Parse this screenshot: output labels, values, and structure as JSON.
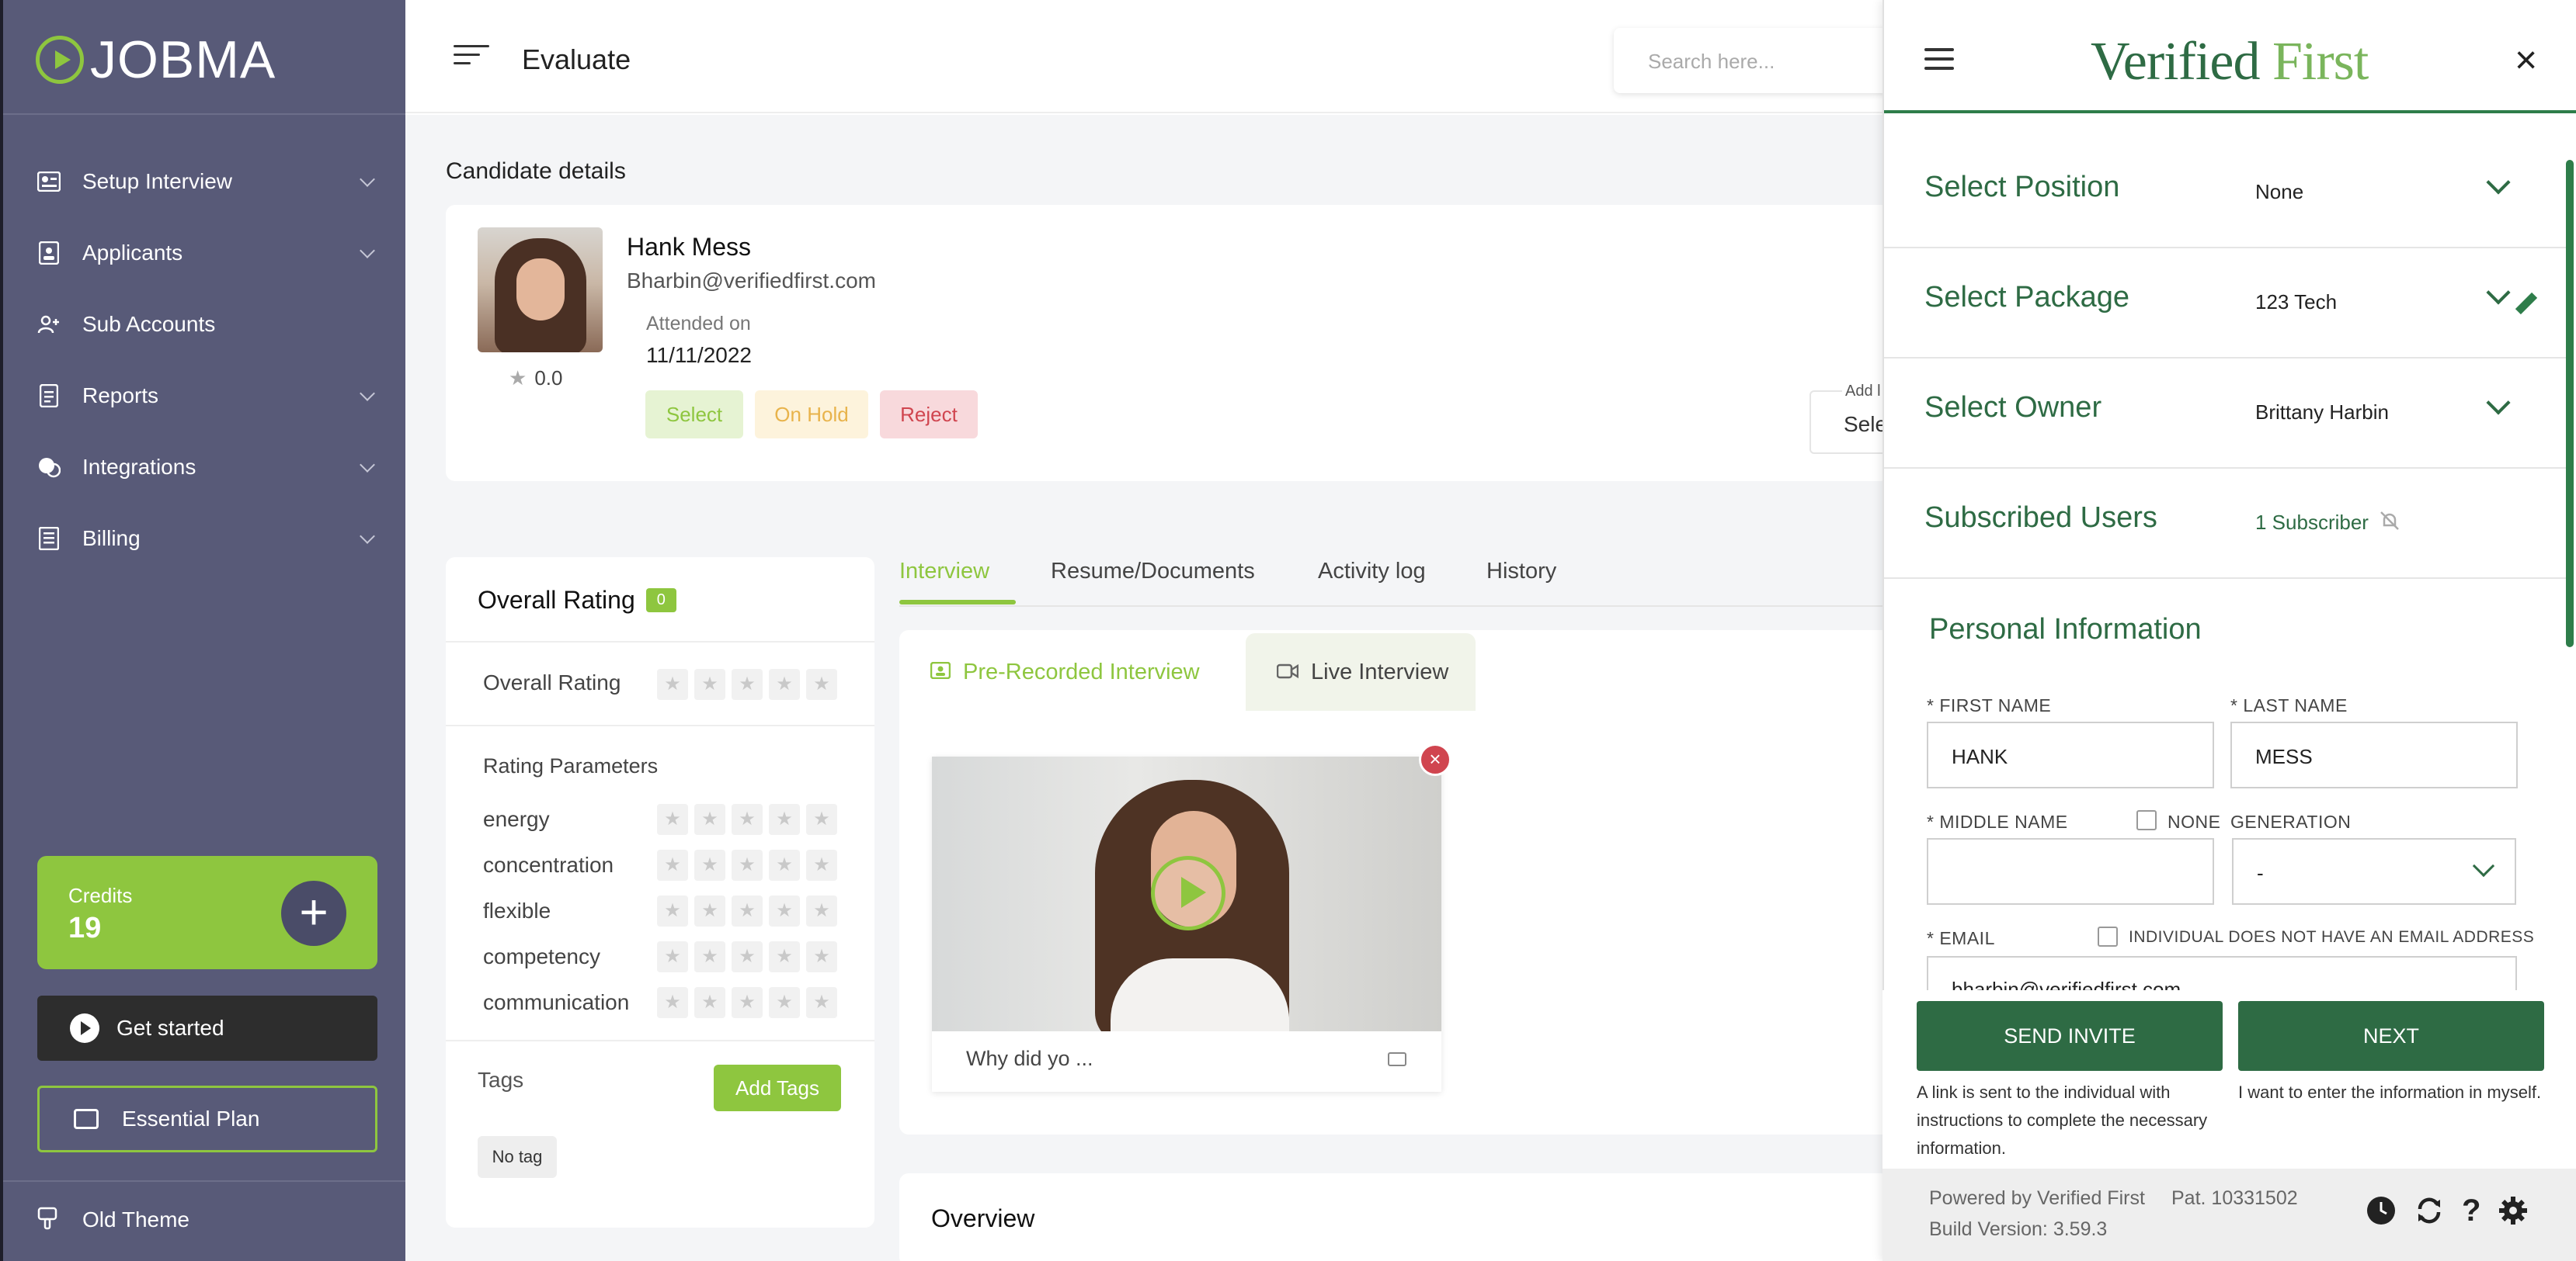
{
  "sidebar": {
    "logo_text": "JOBMA",
    "nav": [
      {
        "label": "Setup Interview",
        "icon": "setup-interview-icon"
      },
      {
        "label": "Applicants",
        "icon": "applicants-icon"
      },
      {
        "label": "Sub Accounts",
        "icon": "sub-accounts-icon"
      },
      {
        "label": "Reports",
        "icon": "reports-icon"
      },
      {
        "label": "Integrations",
        "icon": "integrations-icon"
      },
      {
        "label": "Billing",
        "icon": "billing-icon"
      }
    ],
    "credits_label": "Credits",
    "credits_value": "19",
    "get_started": "Get started",
    "essential_plan": "Essential Plan",
    "old_theme": "Old Theme"
  },
  "topbar": {
    "title": "Evaluate",
    "search_placeholder": "Search here..."
  },
  "candidate": {
    "section_title": "Candidate details",
    "name": "Hank Mess",
    "email": "Bharbin@verifiedfirst.com",
    "attended_label": "Attended on",
    "attended_date": "11/11/2022",
    "rating": "0.0",
    "select": "Select",
    "on_hold": "On Hold",
    "reject": "Reject",
    "add_label": "Add l",
    "add_value": "Sele"
  },
  "ratings": {
    "title": "Overall Rating",
    "badge": "0",
    "overall_label": "Overall Rating",
    "params_title": "Rating Parameters",
    "params": [
      "energy",
      "concentration",
      "flexible",
      "competency",
      "communication"
    ],
    "star_count": 5,
    "tags_label": "Tags",
    "add_tags": "Add Tags",
    "no_tag": "No tag"
  },
  "tabs": {
    "items": [
      "Interview",
      "Resume/Documents",
      "Activity log",
      "History"
    ],
    "active": "Interview",
    "sub_pre": "Pre-Recorded Interview",
    "sub_live": "Live Interview",
    "question": "Why did yo ...",
    "overview": "Overview"
  },
  "verified_first": {
    "logo_main": "Verified",
    "logo_accent": "First",
    "close": "×",
    "rows": [
      {
        "label": "Select Position",
        "value": "None"
      },
      {
        "label": "Select Package",
        "value": "123 Tech"
      },
      {
        "label": "Select Owner",
        "value": "Brittany Harbin"
      },
      {
        "label": "Subscribed Users",
        "value": "1 Subscriber"
      }
    ],
    "personal_info": "Personal Information",
    "first_name_label": "* FIRST NAME",
    "first_name": "HANK",
    "last_name_label": "* LAST NAME",
    "last_name": "MESS",
    "middle_name_label": "* MIDDLE NAME",
    "none_label": "NONE",
    "generation_label": "GENERATION",
    "generation_value": "-",
    "email_label": "* EMAIL",
    "no_email_label": "INDIVIDUAL DOES NOT HAVE AN EMAIL ADDRESS",
    "email_value": "bharbin@verifiedfirst.com",
    "send_invite": "SEND INVITE",
    "next": "NEXT",
    "send_note": "A link is sent to the individual with instructions to complete the necessary information.",
    "next_note": "I want to enter the information in myself.",
    "powered_by": "Powered by Verified First",
    "patent": "Pat. 10331502",
    "build": "Build Version: 3.59.3"
  },
  "colors": {
    "sidebar": "#585a78",
    "accent": "#8ec63f",
    "vf_green": "#2e6b44"
  }
}
